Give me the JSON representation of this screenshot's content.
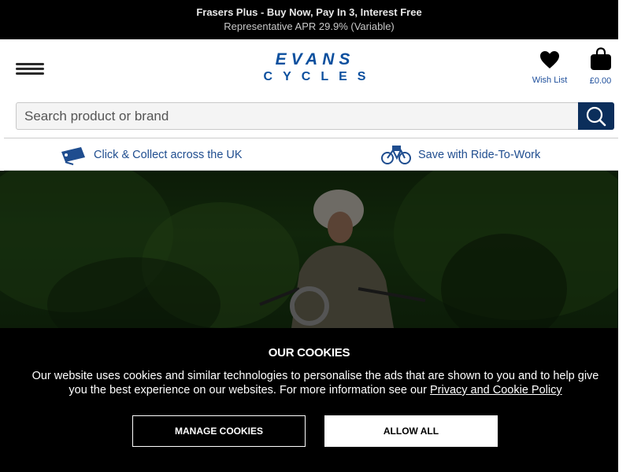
{
  "promo": {
    "line1": "Frasers Plus - Buy Now, Pay In 3, Interest Free",
    "line2": "Representative APR 29.9% (Variable)"
  },
  "header": {
    "logo_top": "EVANS",
    "logo_bottom": "CYCLES",
    "wishlist_label": "Wish List",
    "bag_total": "£0.00"
  },
  "search": {
    "placeholder": "Search product or brand"
  },
  "usp": {
    "collect_label": "Click & Collect across the UK",
    "ride_to_work_label": "Save with Ride-To-Work"
  },
  "cookies": {
    "title": "OUR COOKIES",
    "body": "Our website uses cookies and similar technologies to personalise the ads that are shown to you and to help give you the best experience on our websites. For more information see our ",
    "policy_link": "Privacy and Cookie Policy",
    "manage_label": "MANAGE COOKIES",
    "allow_label": "ALLOW ALL"
  },
  "colors": {
    "brand_blue": "#0b4f9e",
    "link_blue": "#1f4d8f",
    "search_button": "#0b2e5b",
    "banner_bg": "#000000"
  }
}
